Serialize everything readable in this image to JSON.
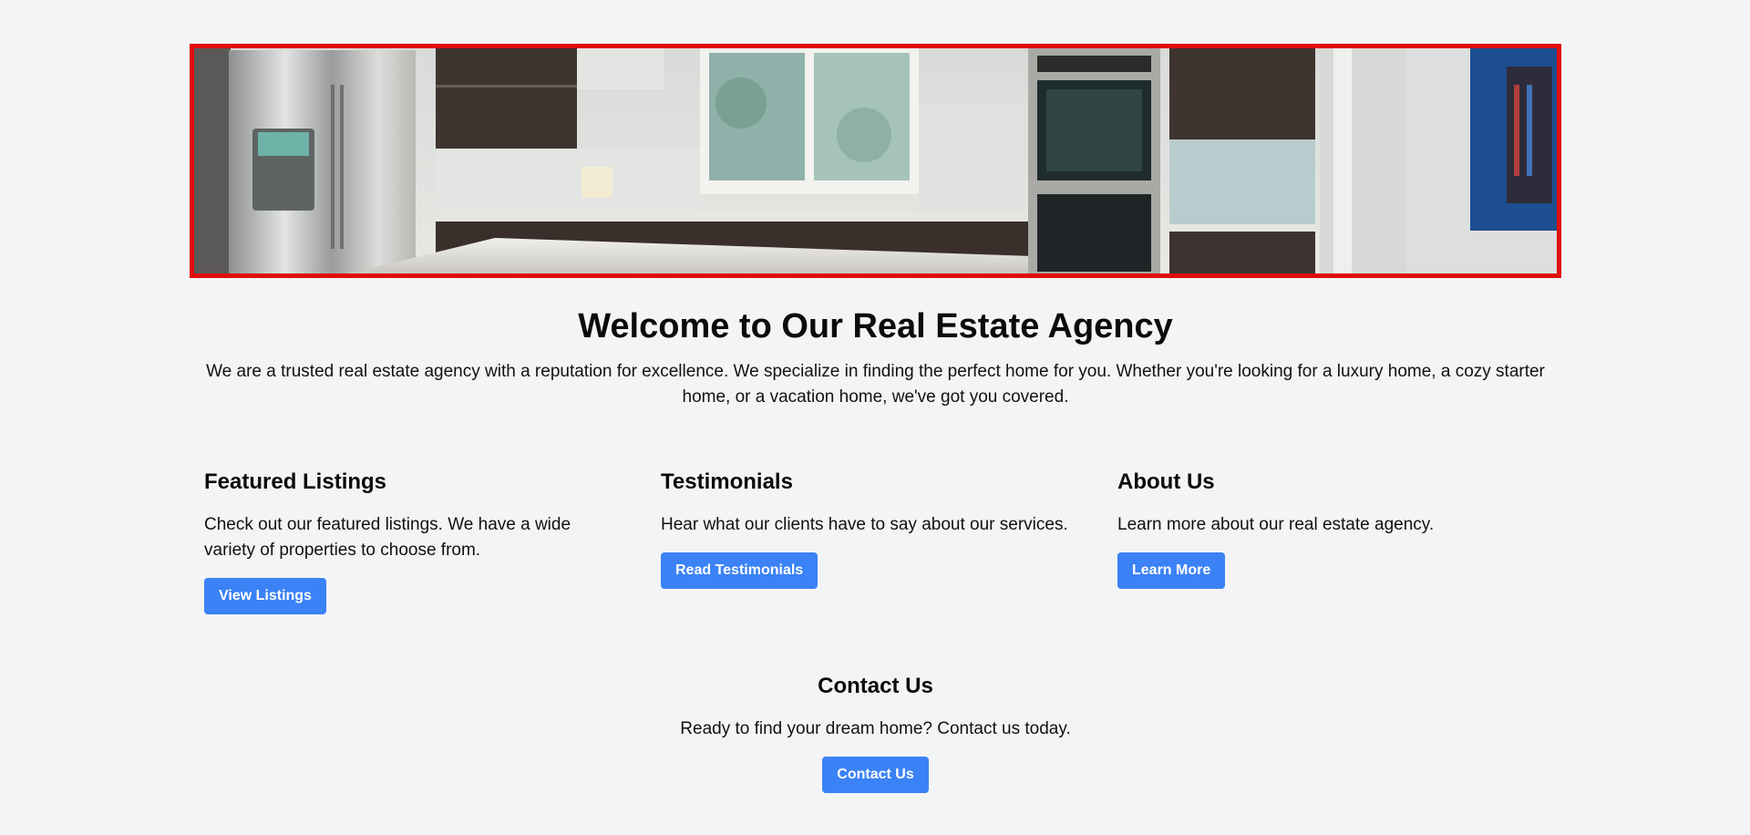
{
  "hero": {
    "image_label": "kitchen-banner-image",
    "border_color": "#e00d0d"
  },
  "welcome": {
    "title": "Welcome to Our Real Estate Agency",
    "description": "We are a trusted real estate agency with a reputation for excellence. We specialize in finding the perfect home for you. Whether you're looking for a luxury home, a cozy starter home, or a vacation home, we've got you covered."
  },
  "features": [
    {
      "title": "Featured Listings",
      "text": "Check out our featured listings. We have a wide variety of properties to choose from.",
      "button": "View Listings"
    },
    {
      "title": "Testimonials",
      "text": "Hear what our clients have to say about our services.",
      "button": "Read Testimonials"
    },
    {
      "title": "About Us",
      "text": "Learn more about our real estate agency.",
      "button": "Learn More"
    }
  ],
  "contact": {
    "title": "Contact Us",
    "text": "Ready to find your dream home? Contact us today.",
    "button": "Contact Us"
  },
  "colors": {
    "accent": "#3b82f6",
    "background": "#f3f4f6"
  }
}
